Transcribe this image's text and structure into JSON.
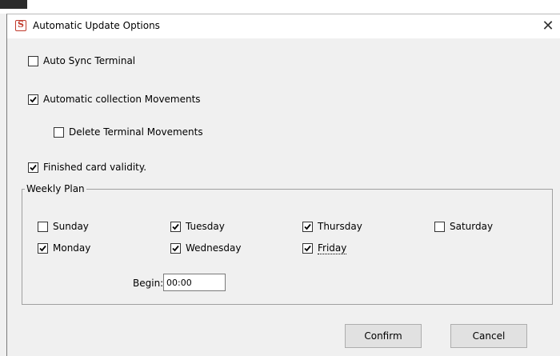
{
  "window": {
    "title": "Automatic Update Options",
    "close_glyph": "✕",
    "app_icon_letter": "S"
  },
  "options": {
    "auto_sync": {
      "label": "Auto Sync Terminal",
      "checked": false
    },
    "auto_collect": {
      "label": "Automatic collection Movements",
      "checked": true
    },
    "delete_terminal": {
      "label": "Delete Terminal Movements",
      "checked": false
    },
    "finished_card": {
      "label": "Finished card validity.",
      "checked": true
    }
  },
  "weekly_plan": {
    "title": "Weekly Plan",
    "days": {
      "sunday": {
        "label": "Sunday",
        "checked": false
      },
      "monday": {
        "label": "Monday",
        "checked": true
      },
      "tuesday": {
        "label": "Tuesday",
        "checked": true
      },
      "wednesday": {
        "label": "Wednesday",
        "checked": true
      },
      "thursday": {
        "label": "Thursday",
        "checked": true
      },
      "friday": {
        "label": "Friday",
        "checked": true
      },
      "saturday": {
        "label": "Saturday",
        "checked": false
      }
    },
    "begin_label": "Begin:",
    "begin_value": "00:00"
  },
  "buttons": {
    "confirm": "Confirm",
    "cancel": "Cancel"
  }
}
